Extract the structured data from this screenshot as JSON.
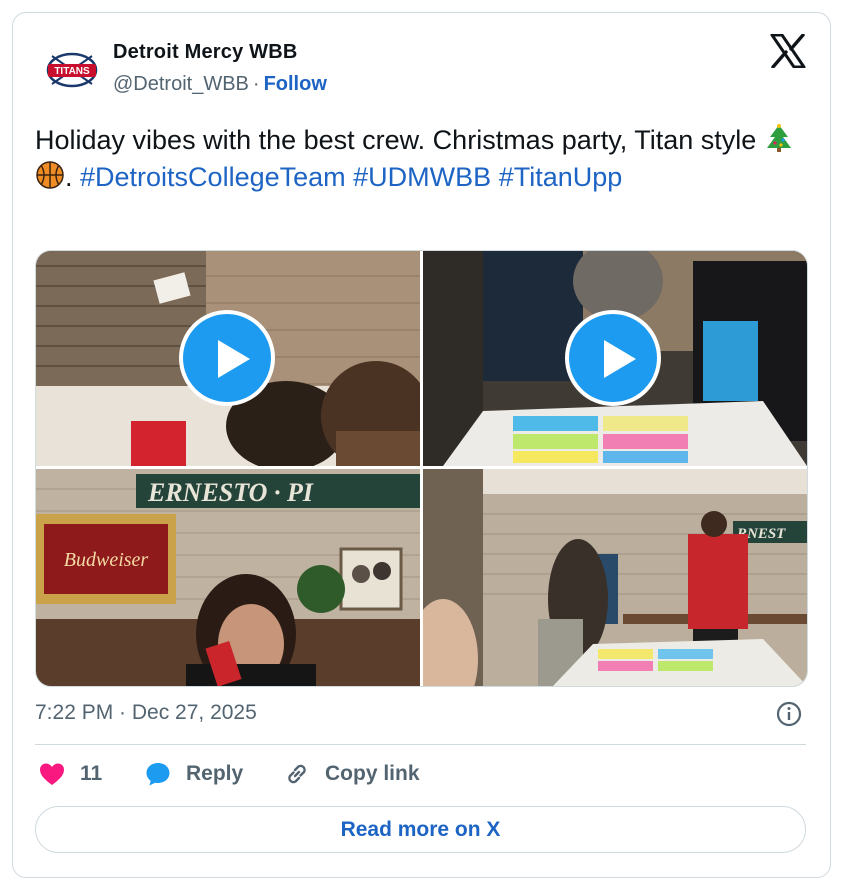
{
  "author": {
    "name": "Detroit Mercy WBB",
    "handle": "@Detroit_WBB",
    "separator": "·",
    "follow_label": "Follow",
    "logo_text": "TITANS"
  },
  "tweet": {
    "text_part1": "Holiday vibes with the best crew. Christmas party, Titan style ",
    "text_part2": ". ",
    "hashtags": [
      "#DetroitsCollegeTeam",
      "#UDMWBB",
      "#TitanUpp"
    ],
    "emojis": [
      "christmas-tree-icon",
      "basketball-icon"
    ]
  },
  "media": {
    "photo_signs": {
      "ernesto_sign": "ERNESTO · PI",
      "budweiser_sign": "Budweiser",
      "right_sign": "RNEST"
    }
  },
  "footer": {
    "timestamp": "7:22 PM · Dec 27, 2025",
    "like_count": "11",
    "reply_label": "Reply",
    "copy_link_label": "Copy link",
    "read_more_label": "Read more on X"
  },
  "colors": {
    "link": "#1d64c4",
    "play": "#1d9bf0",
    "heart": "#f91880",
    "reply": "#1d9bf0",
    "muted": "#536471",
    "border": "#cfd9de"
  }
}
